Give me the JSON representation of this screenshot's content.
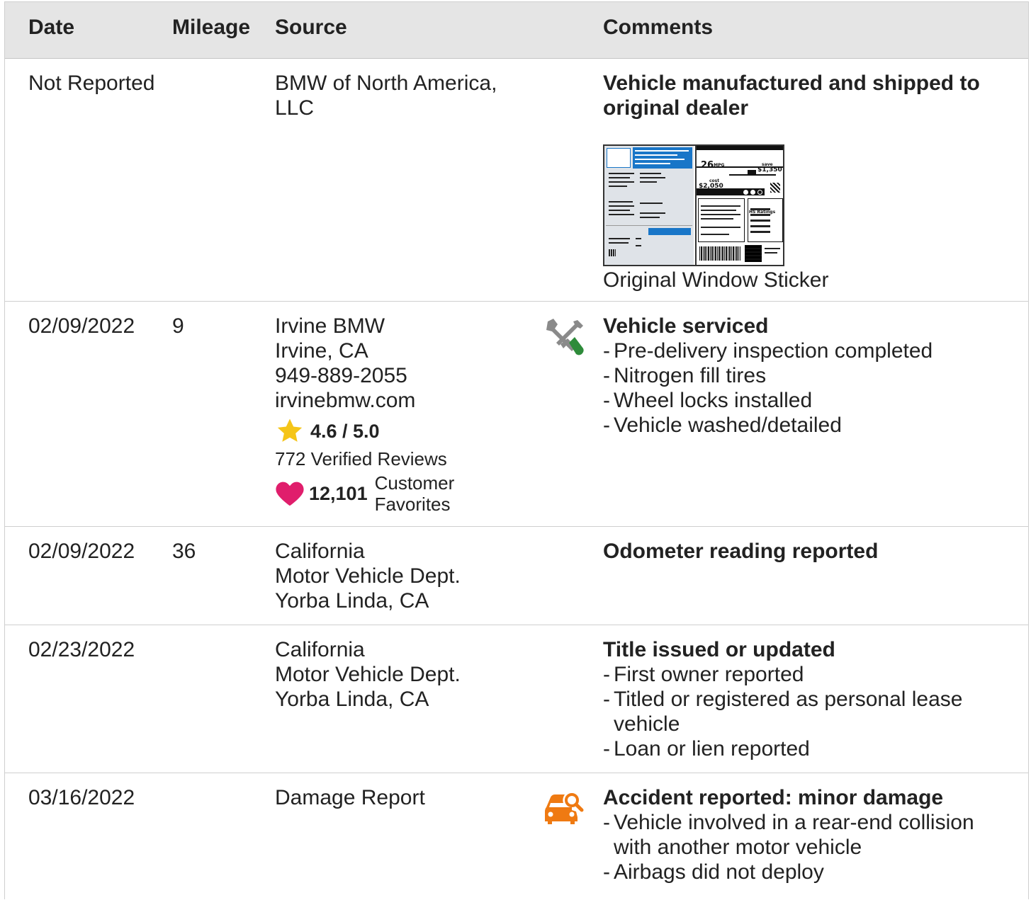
{
  "header": {
    "date": "Date",
    "mileage": "Mileage",
    "source": "Source",
    "comments": "Comments"
  },
  "rows": [
    {
      "date": "Not Reported",
      "mileage": "",
      "source": [
        "BMW of North America,",
        "LLC"
      ],
      "title": [
        "Vehicle manufactured and shipped to",
        "original dealer"
      ],
      "sticker": {
        "mpg": "26",
        "mpg_unit": "MPG",
        "save": "save",
        "save_amount": "$1,350",
        "cost_label": "cost",
        "cost_amount": "$2,050",
        "ratings_label": "HS Ratings",
        "caption": "Original Window Sticker"
      }
    },
    {
      "date": "02/09/2022",
      "mileage": "9",
      "icon": "wrench-screwdriver-icon",
      "source": [
        "Irvine BMW",
        "Irvine, CA",
        "949-889-2055",
        "irvinebmw.com"
      ],
      "rating_score": "4.6 / 5.0",
      "reviews": "772 Verified Reviews",
      "favorites_count": "12,101",
      "favorites_label": [
        "Customer",
        "Favorites"
      ],
      "title": "Vehicle serviced",
      "bullets": [
        "Pre-delivery inspection completed",
        "Nitrogen fill tires",
        "Wheel locks installed",
        "Vehicle washed/detailed"
      ]
    },
    {
      "date": "02/09/2022",
      "mileage": "36",
      "source": [
        "California",
        "Motor Vehicle Dept.",
        "Yorba Linda, CA"
      ],
      "title": "Odometer reading reported"
    },
    {
      "date": "02/23/2022",
      "mileage": "",
      "source": [
        "California",
        "Motor Vehicle Dept.",
        "Yorba Linda, CA"
      ],
      "title": "Title issued or updated",
      "bullets": [
        "First owner reported",
        "Titled or registered as personal lease vehicle",
        "Loan or lien reported"
      ]
    },
    {
      "date": "03/16/2022",
      "mileage": "",
      "icon": "car-search-icon",
      "source": [
        "Damage Report"
      ],
      "title": "Accident reported: minor damage",
      "bullets": [
        "Vehicle involved in a rear-end collision with another motor vehicle",
        "Airbags did not deploy"
      ]
    }
  ],
  "colors": {
    "header_bg": "#e5e5e5",
    "star": "#f5c518",
    "heart": "#e01e6c",
    "wrench": "#8a8a8a",
    "screwdriver": "#2e8b3a",
    "accident": "#ef7a12",
    "sticker_blue": "#1976c8"
  }
}
